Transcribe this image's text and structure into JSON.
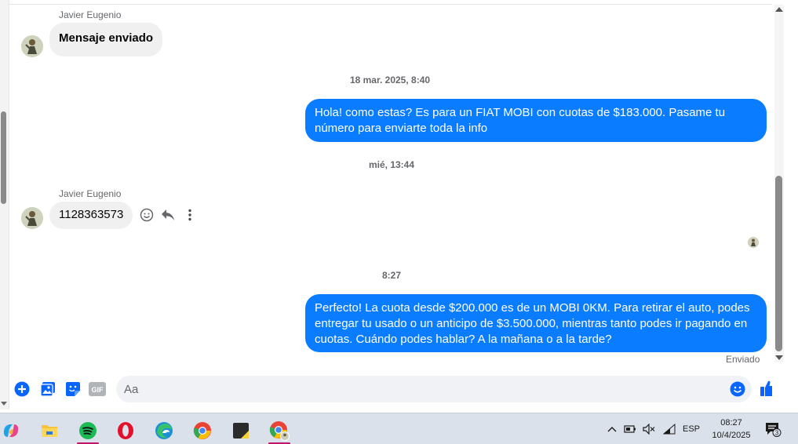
{
  "messages": {
    "in1": {
      "sender": "Javier Eugenio",
      "text": "Mensaje enviado"
    },
    "ts1": "18 mar. 2025, 8:40",
    "out1": {
      "text": "Hola! como estas? Es para un FIAT MOBI con cuotas de $183.000. Pasame tu número para enviarte toda la info"
    },
    "ts2": "mié, 13:44",
    "in2": {
      "sender": "Javier Eugenio",
      "text": "1128363573"
    },
    "ts3": "8:27",
    "out2": {
      "text": "Perfecto! La cuota desde $200.000 es de un MOBI 0KM. Para retirar el auto, podes entregar tu usado o un anticipo de $3.500.000, mientras tanto podes ir pagando en cuotas. Cuándo podes hablar? A la mañana o a la tarde?"
    },
    "status": "Enviado"
  },
  "message_actions": [
    "smiley-icon",
    "reply-icon",
    "more-options-icon"
  ],
  "composer": {
    "placeholder": "Aa",
    "icons": [
      "add-icon",
      "photo-icon",
      "sticker-icon",
      "gif-icon",
      "emoji-icon",
      "like-thumb-icon"
    ],
    "gif_label": "GIF"
  },
  "colors": {
    "outgoing_bubble": "#0a7cff",
    "incoming_bubble": "#f0f0f0",
    "accent": "#0866ff",
    "taskbar": "#dbe1ea"
  },
  "taskbar": {
    "apps": [
      "copilot-icon",
      "file-explorer-icon",
      "spotify-icon",
      "opera-icon",
      "edge-icon",
      "chrome-icon",
      "sticky-notes-icon",
      "chrome-profile-icon"
    ],
    "tray": {
      "language": "ESP",
      "time": "08:27",
      "date": "10/4/2025",
      "notification_count": "3"
    }
  }
}
